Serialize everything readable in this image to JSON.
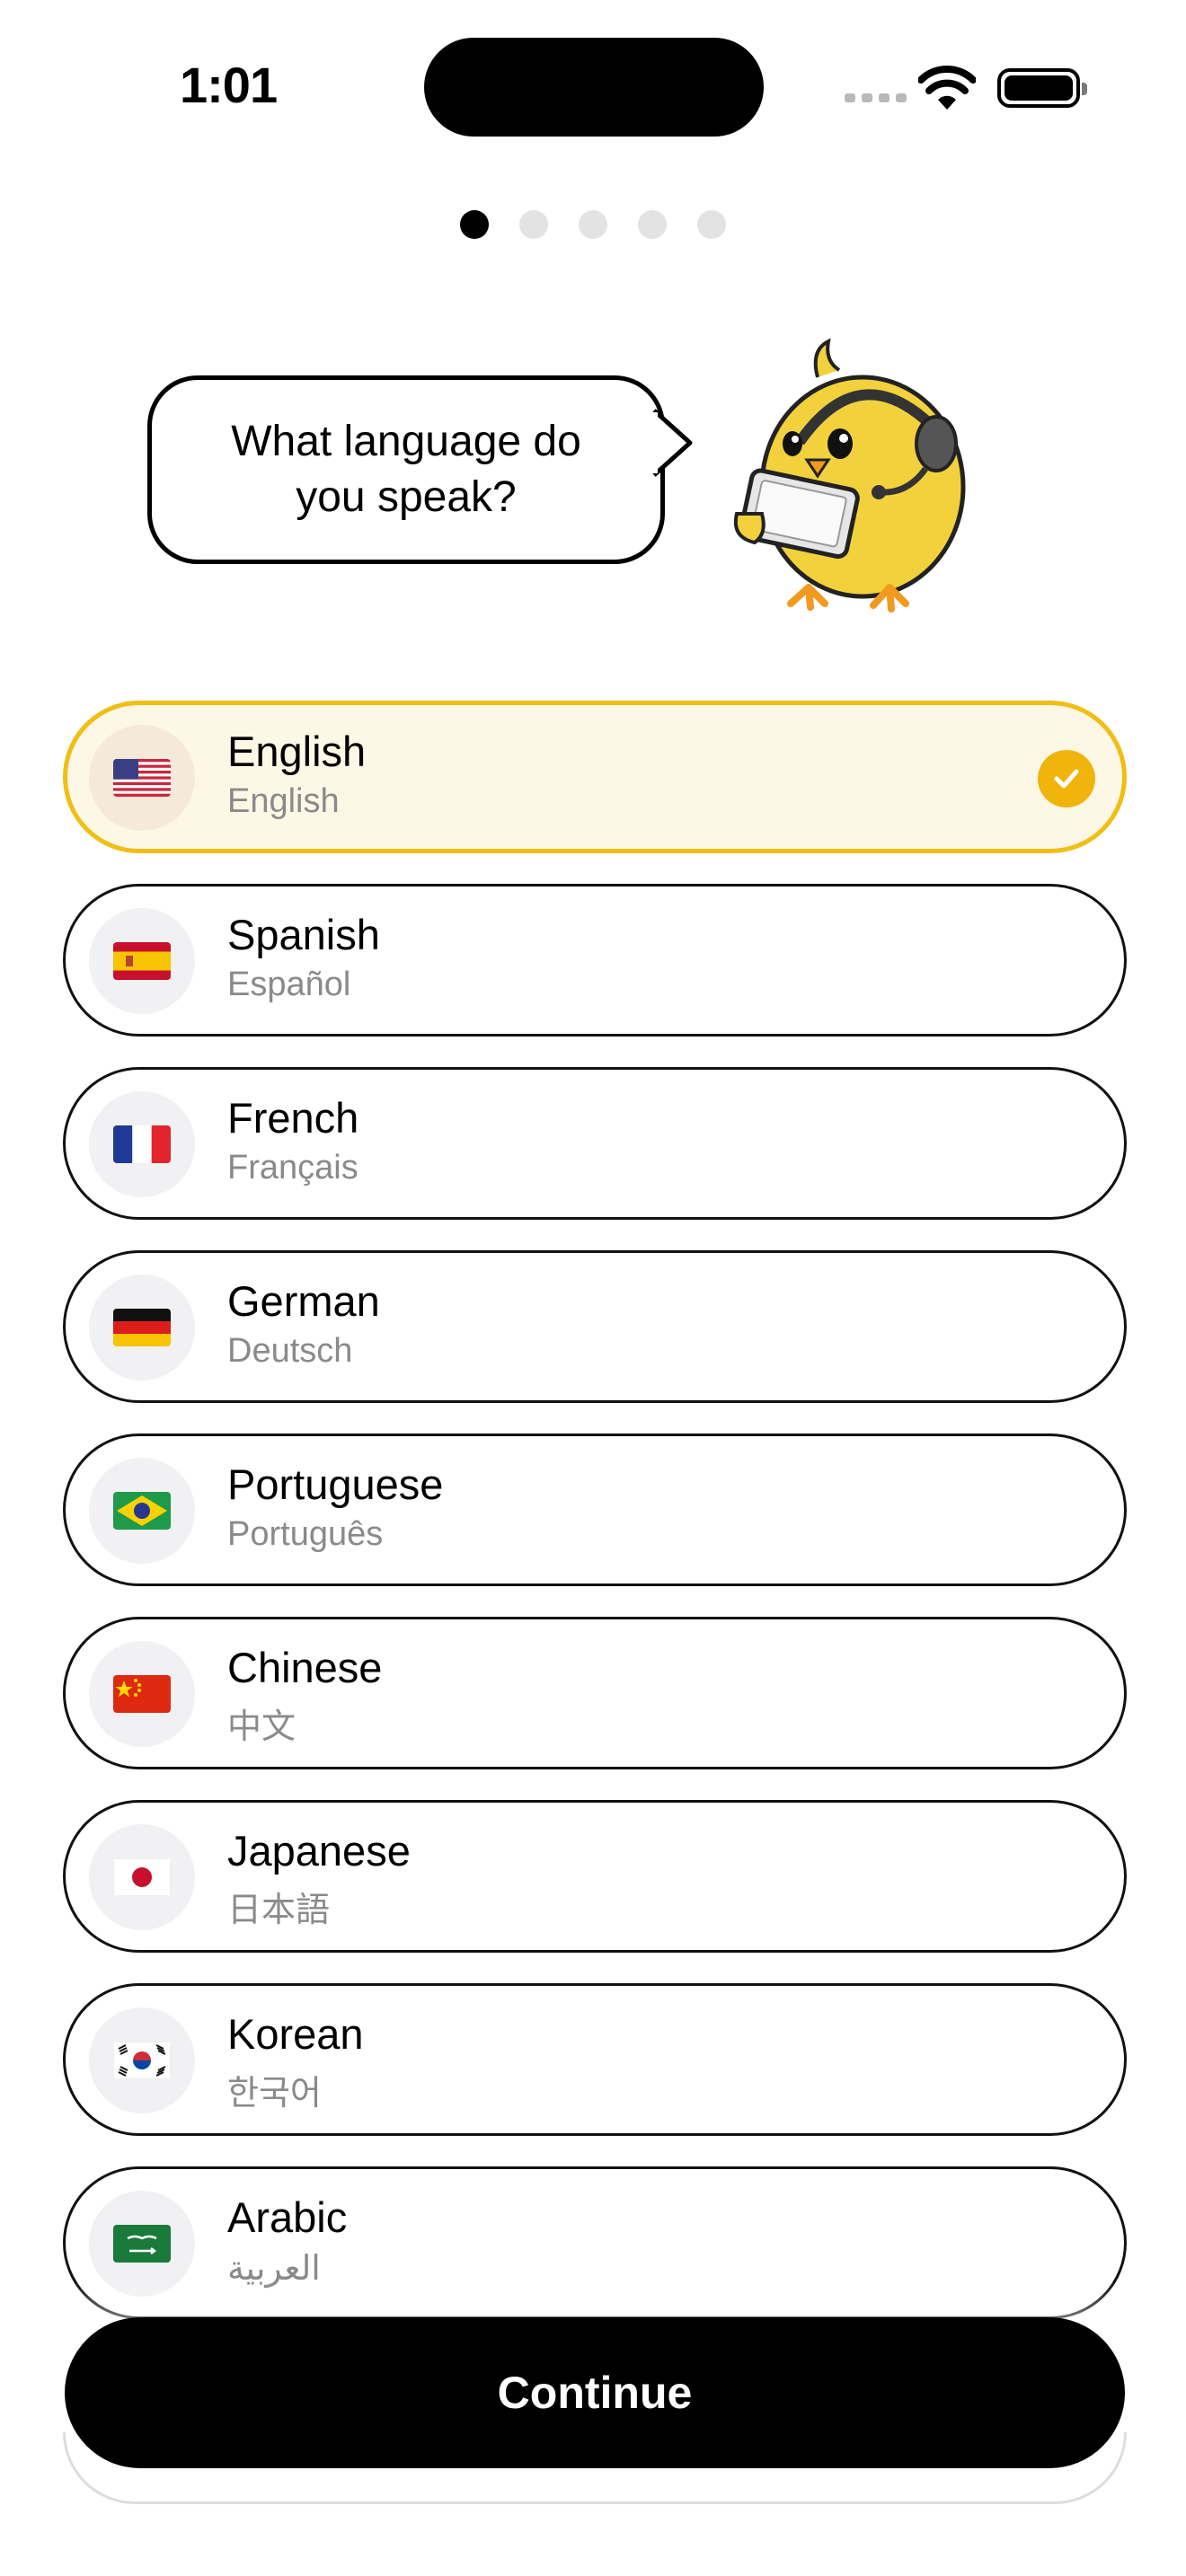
{
  "status_bar": {
    "time": "1:01"
  },
  "pager": {
    "total": 5,
    "active": 0
  },
  "prompt": {
    "text": "What language do you speak?"
  },
  "languages": [
    {
      "name": "English",
      "native": "English",
      "flag": "us-flag-icon",
      "selected": true
    },
    {
      "name": "Spanish",
      "native": "Español",
      "flag": "es-flag-icon",
      "selected": false
    },
    {
      "name": "French",
      "native": "Français",
      "flag": "fr-flag-icon",
      "selected": false
    },
    {
      "name": "German",
      "native": "Deutsch",
      "flag": "de-flag-icon",
      "selected": false
    },
    {
      "name": "Portuguese",
      "native": "Português",
      "flag": "br-flag-icon",
      "selected": false
    },
    {
      "name": "Chinese",
      "native": "中文",
      "flag": "cn-flag-icon",
      "selected": false
    },
    {
      "name": "Japanese",
      "native": "日本語",
      "flag": "jp-flag-icon",
      "selected": false
    },
    {
      "name": "Korean",
      "native": "한국어",
      "flag": "kr-flag-icon",
      "selected": false
    },
    {
      "name": "Arabic",
      "native": "العربية",
      "flag": "sa-flag-icon",
      "selected": false
    }
  ],
  "colors": {
    "selected_border": "#F0BE14",
    "selected_bg": "#FDF8E6",
    "check": "#F0B40A"
  },
  "footer": {
    "continue_label": "Continue"
  }
}
